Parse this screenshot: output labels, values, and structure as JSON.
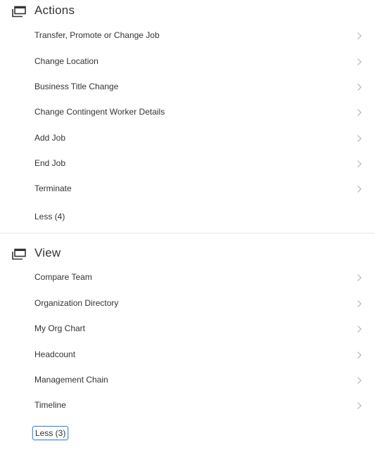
{
  "actions": {
    "title": "Actions",
    "icon": "windows-icon",
    "items": [
      {
        "label": "Transfer, Promote or Change Job"
      },
      {
        "label": "Change Location"
      },
      {
        "label": "Business Title Change"
      },
      {
        "label": "Change Contingent Worker Details"
      },
      {
        "label": "Add Job"
      },
      {
        "label": "End Job"
      },
      {
        "label": "Terminate"
      }
    ],
    "less_label": "Less (4)"
  },
  "view": {
    "title": "View",
    "icon": "windows-icon",
    "items": [
      {
        "label": "Compare Team"
      },
      {
        "label": "Organization Directory"
      },
      {
        "label": "My Org Chart"
      },
      {
        "label": "Headcount"
      },
      {
        "label": "Management Chain"
      },
      {
        "label": "Timeline"
      }
    ],
    "less_label": "Less (3)"
  },
  "colors": {
    "text": "#333333",
    "chevron": "#b3b3b3",
    "divider": "#e6e6e6",
    "focus": "#4a90e2"
  }
}
